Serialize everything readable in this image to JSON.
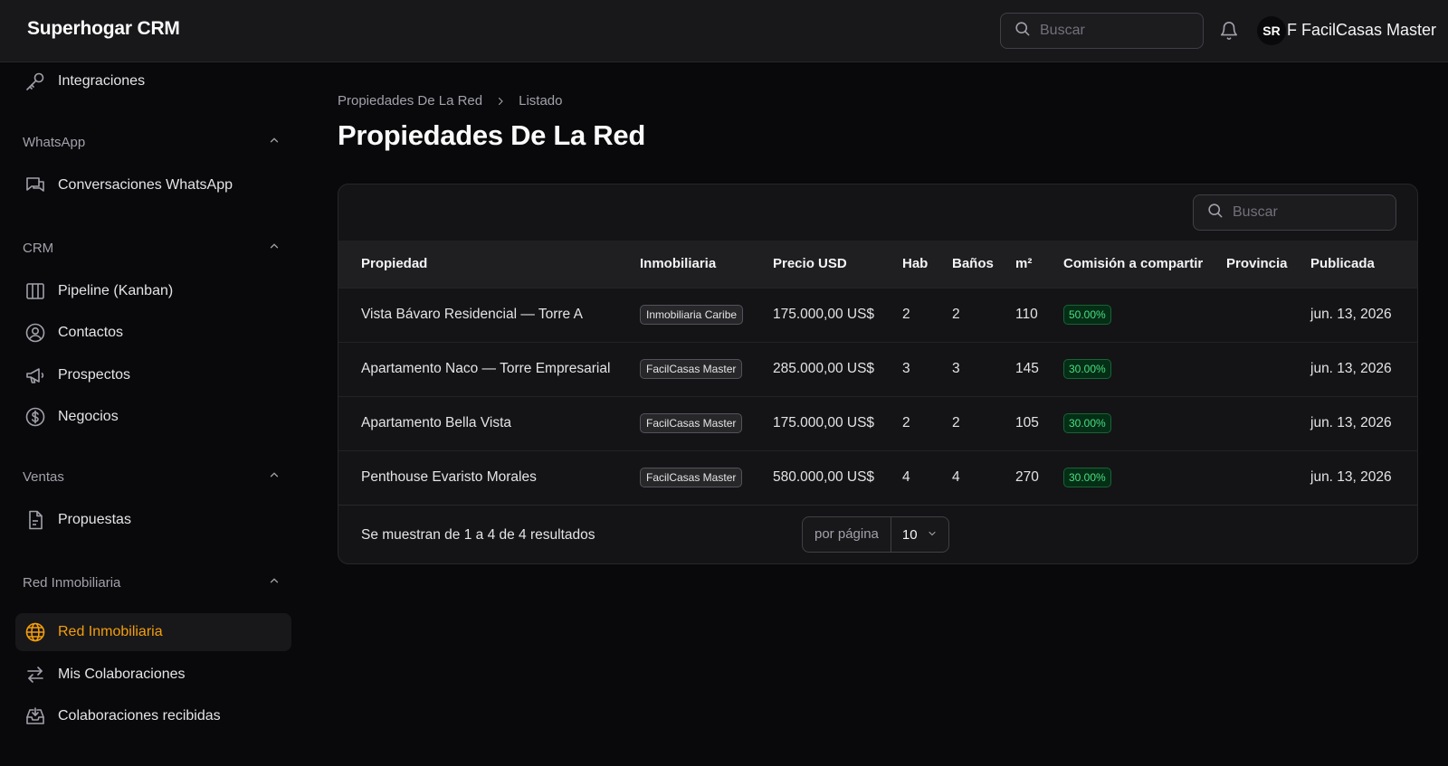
{
  "app": {
    "title": "Superhogar CRM"
  },
  "header": {
    "search_placeholder": "Buscar",
    "avatar_initials": "SR",
    "user_name": "F FacilCasas Master"
  },
  "sidebar": {
    "top_item": {
      "label": "Integraciones",
      "icon": "key-icon"
    },
    "groups": [
      {
        "label": "WhatsApp",
        "items": [
          {
            "label": "Conversaciones WhatsApp",
            "icon": "chat-icon"
          }
        ]
      },
      {
        "label": "CRM",
        "items": [
          {
            "label": "Pipeline (Kanban)",
            "icon": "kanban-icon"
          },
          {
            "label": "Contactos",
            "icon": "user-circle-icon"
          },
          {
            "label": "Prospectos",
            "icon": "megaphone-icon"
          },
          {
            "label": "Negocios",
            "icon": "dollar-icon"
          }
        ]
      },
      {
        "label": "Ventas",
        "items": [
          {
            "label": "Propuestas",
            "icon": "document-icon"
          }
        ]
      },
      {
        "label": "Red Inmobiliaria",
        "items": [
          {
            "label": "Red Inmobiliaria",
            "icon": "globe-icon",
            "active": true
          },
          {
            "label": "Mis Colaboraciones",
            "icon": "arrows-icon"
          },
          {
            "label": "Colaboraciones recibidas",
            "icon": "inbox-icon"
          }
        ]
      }
    ],
    "active_color": "#f59e0b"
  },
  "breadcrumb": {
    "parent": "Propiedades De La Red",
    "current": "Listado"
  },
  "page": {
    "title": "Propiedades De La Red"
  },
  "table": {
    "search_placeholder": "Buscar",
    "columns": [
      "Propiedad",
      "Inmobiliaria",
      "Precio USD",
      "Hab",
      "Baños",
      "m²",
      "Comisión a compartir",
      "Provincia",
      "Publicada"
    ],
    "rows": [
      {
        "propiedad": "Vista Bávaro Residencial — Torre A",
        "inmobiliaria": "Inmobiliaria Caribe",
        "precio": "175.000,00 US$",
        "hab": "2",
        "banos": "2",
        "m2": "110",
        "comision": "50.00%",
        "provincia": "",
        "publicada": "jun. 13, 2026"
      },
      {
        "propiedad": "Apartamento Naco — Torre Empresarial",
        "inmobiliaria": "FacilCasas Master",
        "precio": "285.000,00 US$",
        "hab": "3",
        "banos": "3",
        "m2": "145",
        "comision": "30.00%",
        "provincia": "",
        "publicada": "jun. 13, 2026"
      },
      {
        "propiedad": "Apartamento Bella Vista",
        "inmobiliaria": "FacilCasas Master",
        "precio": "175.000,00 US$",
        "hab": "2",
        "banos": "2",
        "m2": "105",
        "comision": "30.00%",
        "provincia": "",
        "publicada": "jun. 13, 2026"
      },
      {
        "propiedad": "Penthouse Evaristo Morales",
        "inmobiliaria": "FacilCasas Master",
        "precio": "580.000,00 US$",
        "hab": "4",
        "banos": "4",
        "m2": "270",
        "comision": "30.00%",
        "provincia": "",
        "publicada": "jun. 13, 2026"
      }
    ],
    "summary": "Se muestran de 1 a 4 de 4 resultados",
    "per_page_label": "por página",
    "per_page_value": "10"
  }
}
